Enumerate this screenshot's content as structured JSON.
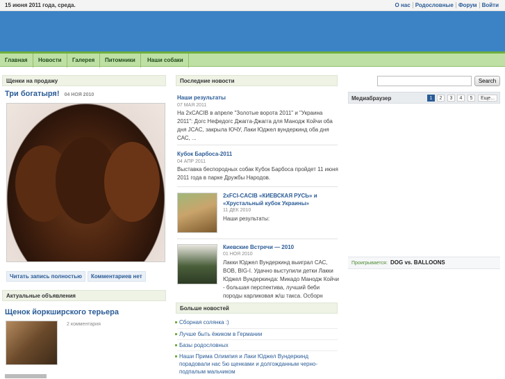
{
  "topbar": {
    "date": "15 июня 2011 года, среда.",
    "links": [
      "О нас",
      "Родословные",
      "Форум",
      "Войти"
    ]
  },
  "nav": {
    "items": [
      "Главная",
      "Новости",
      "Галерея",
      "Питомники",
      "Наши собаки"
    ]
  },
  "left": {
    "heading": "Щенки на продажу",
    "post_title": "Три богатыря!",
    "post_date": "04 НОЯ 2010",
    "read_more": "Читать запись полностью",
    "no_comments": "Комментариев нет",
    "ads_heading": "Актуальные объявления",
    "ad_title": "Щенок йоркширского терьера",
    "ad_comments": "2 комментария"
  },
  "middle": {
    "heading": "Последние новости",
    "news": [
      {
        "title": "Наши результаты",
        "date": "07 МАЯ 2011",
        "text": "На 2хСАСIВ в апреле \"Золотые ворота 2011\" и \"Украина 2011\": Догс Нефедогс Джагга-Джагга для Манодж Койчи оба дня JCAC, закрыла ЮЧУ, Лаки Юджел вундеркинд оба дня САС, ..."
      },
      {
        "title": "Кубок Барбоса-2011",
        "date": "04 АПР 2011",
        "text": "Выставка беспородных собак Кубок Барбоса пройдет 11 июня 2011 года в парке Дружбы Народов."
      },
      {
        "title": "2хFCI-CACIB «КИЕВСКАЯ РУСЬ» и «Хрустальный кубок Украины»",
        "date": "11 ДЕК 2010",
        "text": "Наши результаты:"
      },
      {
        "title": "Киевские Встречи — 2010",
        "date": "01 НОЯ 2010",
        "text": "Лакки Юджел Вундеркинд выиграл САС, BOB, BIG-I. Удачно выступили детки Лакки Юджел Вундеркинда: Микадо Манодж Койчи - большая перспектива, лучший беби породы карликовая ж/ш такса. Осборн Манодж Койчи ..."
      }
    ],
    "more_heading": "Больше новостей",
    "more": [
      "Сборная солянка :)",
      "Лучше быть ёжиком в Германии",
      "Базы родословных",
      "Наши Прима Олимпия и Лаки Юджел Вундеркинд порадовали нас 5ю щенками и долгожданным черно-подпалым мальчиком"
    ]
  },
  "right": {
    "search_button": "Search",
    "search_value": "",
    "media_heading": "Медиабраузер",
    "pages": [
      "1",
      "2",
      "3",
      "4",
      "5"
    ],
    "more_pages": "Еще...",
    "playing_label": "Проигрывается:",
    "playing_title": "DOG vs. BALLOONS"
  },
  "colors": {
    "header_blue": "#3b83c4",
    "nav_green": "#bfe0a4",
    "link_blue": "#2a5b96"
  }
}
